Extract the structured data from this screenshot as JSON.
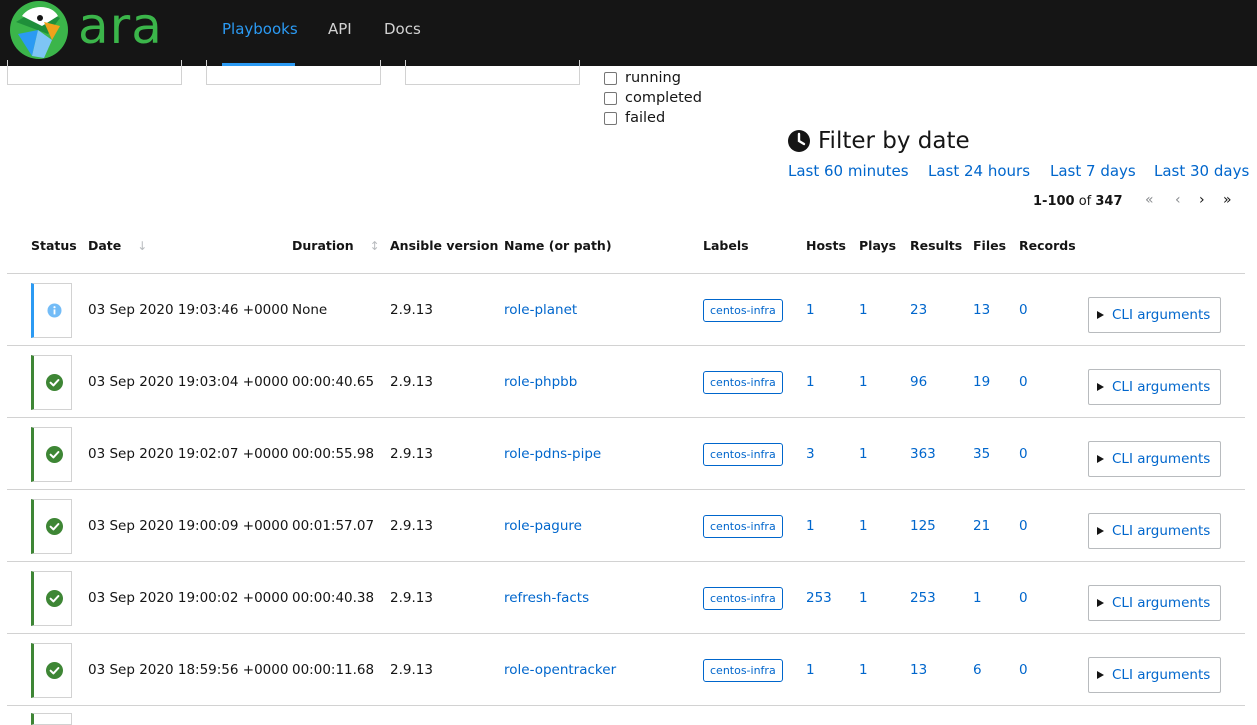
{
  "app": {
    "logo_text": "ara",
    "accent": "#2b9af3",
    "brand_green": "#3bb54a"
  },
  "nav": [
    {
      "label": "Playbooks",
      "active": true
    },
    {
      "label": "API",
      "active": false
    },
    {
      "label": "Docs",
      "active": false
    }
  ],
  "status_filters": [
    {
      "label": "running",
      "checked": false
    },
    {
      "label": "completed",
      "checked": false
    },
    {
      "label": "failed",
      "checked": false
    }
  ],
  "date_filter": {
    "title": "Filter by date",
    "icon": "clock-icon",
    "links": [
      "Last 60 minutes",
      "Last 24 hours",
      "Last 7 days",
      "Last 30 days"
    ]
  },
  "pagination": {
    "range": "1-100",
    "of": "of",
    "total": "347"
  },
  "table": {
    "headers": [
      "Status",
      "Date",
      "Duration",
      "Ansible version",
      "Name (or path)",
      "Labels",
      "Hosts",
      "Plays",
      "Results",
      "Files",
      "Records"
    ],
    "cli_label": "CLI arguments",
    "rows": [
      {
        "status": "info",
        "date": "03 Sep 2020 19:03:46 +0000",
        "duration": "None",
        "ansible": "2.9.13",
        "name": "role-planet",
        "label": "centos-infra",
        "hosts": "1",
        "plays": "1",
        "results": "23",
        "files": "13",
        "records": "0"
      },
      {
        "status": "completed",
        "date": "03 Sep 2020 19:03:04 +0000",
        "duration": "00:00:40.65",
        "ansible": "2.9.13",
        "name": "role-phpbb",
        "label": "centos-infra",
        "hosts": "1",
        "plays": "1",
        "results": "96",
        "files": "19",
        "records": "0"
      },
      {
        "status": "completed",
        "date": "03 Sep 2020 19:02:07 +0000",
        "duration": "00:00:55.98",
        "ansible": "2.9.13",
        "name": "role-pdns-pipe",
        "label": "centos-infra",
        "hosts": "3",
        "plays": "1",
        "results": "363",
        "files": "35",
        "records": "0"
      },
      {
        "status": "completed",
        "date": "03 Sep 2020 19:00:09 +0000",
        "duration": "00:01:57.07",
        "ansible": "2.9.13",
        "name": "role-pagure",
        "label": "centos-infra",
        "hosts": "1",
        "plays": "1",
        "results": "125",
        "files": "21",
        "records": "0"
      },
      {
        "status": "completed",
        "date": "03 Sep 2020 19:00:02 +0000",
        "duration": "00:00:40.38",
        "ansible": "2.9.13",
        "name": "refresh-facts",
        "label": "centos-infra",
        "hosts": "253",
        "plays": "1",
        "results": "253",
        "files": "1",
        "records": "0"
      },
      {
        "status": "completed",
        "date": "03 Sep 2020 18:59:56 +0000",
        "duration": "00:00:11.68",
        "ansible": "2.9.13",
        "name": "role-opentracker",
        "label": "centos-infra",
        "hosts": "1",
        "plays": "1",
        "results": "13",
        "files": "6",
        "records": "0"
      }
    ]
  }
}
